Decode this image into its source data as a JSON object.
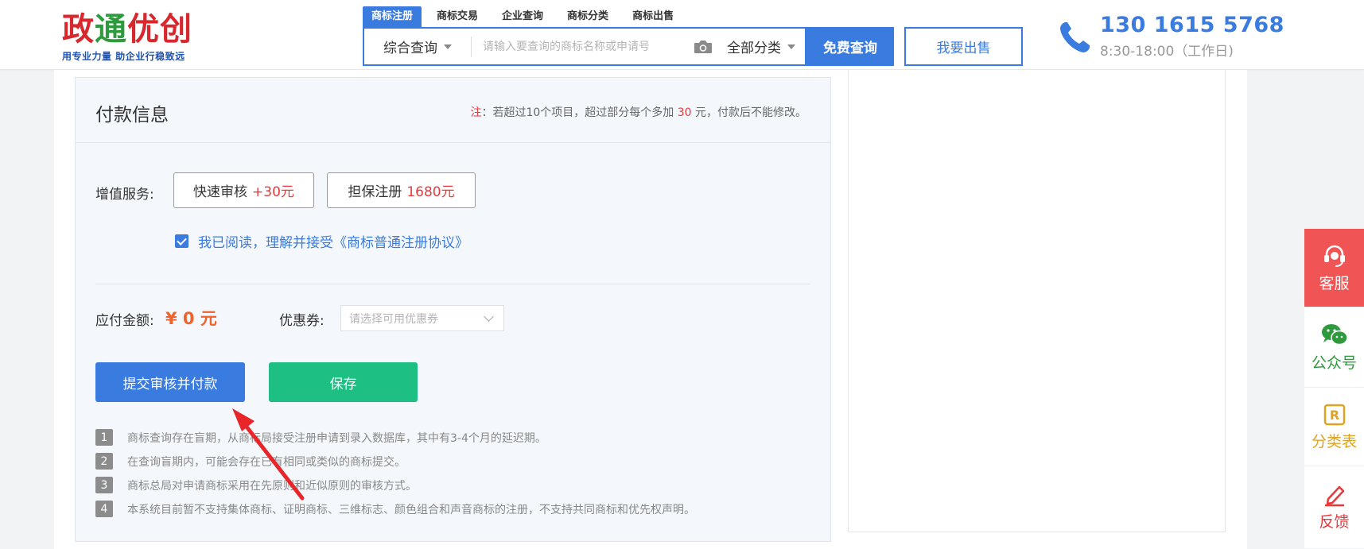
{
  "header": {
    "logo": {
      "title_part1": "政",
      "title_part2": "通",
      "title_part3": "优创",
      "slogan": "用专业力量 助企业行稳致远"
    },
    "category_tabs": [
      "商标注册",
      "商标交易",
      "企业查询",
      "商标分类",
      "商标出售"
    ],
    "search": {
      "scope": "综合查询",
      "placeholder": "请输入要查询的商标名称或申请号",
      "category": "全部分类",
      "button": "免费查询"
    },
    "sell_button": "我要出售",
    "phone": {
      "number": "130 1615 5768",
      "hours": "8:30-18:00（工作日)"
    }
  },
  "payment": {
    "title": "付款信息",
    "note": {
      "prefix": "注",
      "text_before": "：若超过10个项目，超过部分每个多加 ",
      "amount": "30",
      "text_after": " 元，付款后不能修改。"
    },
    "value_added": {
      "label": "增值服务:",
      "services": [
        {
          "name": "快速审核",
          "price": "+30元"
        },
        {
          "name": "担保注册",
          "price": "1680元"
        }
      ]
    },
    "agreement": {
      "checked": true,
      "text": "我已阅读，理解并接受《商标普通注册协议》"
    },
    "amount": {
      "label": "应付金额:",
      "value": "¥ 0 元"
    },
    "coupon": {
      "label": "优惠券:",
      "placeholder": "请选择可用优惠券"
    },
    "submit_button": "提交审核并付款",
    "save_button": "保存",
    "notes": [
      {
        "num": "1",
        "text": "商标查询存在盲期，从商标局接受注册申请到录入数据库，其中有3-4个月的延迟期。"
      },
      {
        "num": "2",
        "text": "在查询盲期内，可能会存在已有相同或类似的商标提交。"
      },
      {
        "num": "3",
        "text": "商标总局对申请商标采用在先原则和近似原则的审核方式。"
      },
      {
        "num": "4",
        "text": "本系统目前暂不支持集体商标、证明商标、三维标志、颜色组合和声音商标的注册，不支持共同商标和优先权声明。"
      }
    ]
  },
  "float_bar": {
    "items": [
      {
        "label": "客服",
        "icon": "headset-icon"
      },
      {
        "label": "公众号",
        "icon": "wechat-icon"
      },
      {
        "label": "分类表",
        "icon": "registered-icon"
      },
      {
        "label": "反馈",
        "icon": "edit-icon"
      }
    ]
  },
  "colors": {
    "primary": "#3a7be0",
    "save_green": "#1dbf82",
    "amount_orange": "#f0632a",
    "red": "#e8393c",
    "kefu_red": "#f05454"
  }
}
